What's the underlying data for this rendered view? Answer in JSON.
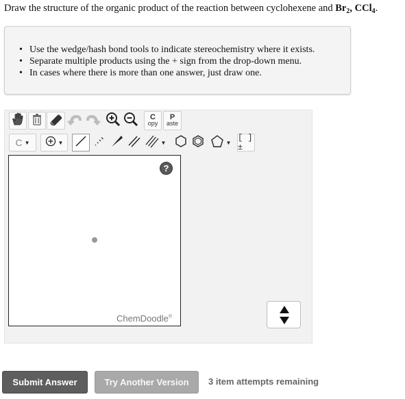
{
  "question": {
    "prefix": "Draw the structure of the organic product of the reaction between cyclohexene and ",
    "reagent1_base": "Br",
    "reagent1_sub": "2",
    "separator": ", ",
    "reagent2_base": "CCl",
    "reagent2_sub": "4",
    "suffix": "."
  },
  "instructions": [
    "Use the wedge/hash bond tools to indicate stereochemistry where it exists.",
    "Separate multiple products using the + sign from the drop-down menu.",
    "In cases where there is more than one answer, just draw one."
  ],
  "toolbar": {
    "copy_top": "C",
    "copy_bottom": "opy",
    "paste_top": "P",
    "paste_bottom": "aste",
    "element_label": "C",
    "charge_label": "[ ]±"
  },
  "canvas": {
    "help_label": "?",
    "brand": "ChemDoodle",
    "brand_mark": "®"
  },
  "actions": {
    "submit_label": "Submit Answer",
    "another_label": "Try Another Version",
    "attempts_text": "3 item attempts remaining"
  },
  "colors": {
    "submit_bg": "#5e5e5e",
    "another_bg": "#a9a9a9",
    "panel_bg": "#f4f4f4",
    "editor_bg": "#f2f2f2"
  }
}
